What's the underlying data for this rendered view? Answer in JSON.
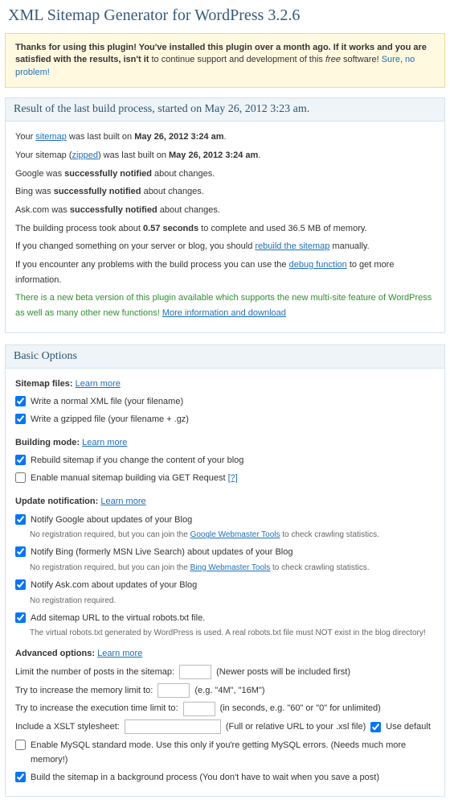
{
  "title": "XML Sitemap Generator for WordPress 3.2.6",
  "banner": {
    "text_before": "Thanks for using this plugin! You've installed this plugin over a month ago. If it works and you are satisfied with the results, isn't it",
    "text_after": " to continue support and development of this ",
    "free": "free",
    "software": " software! ",
    "link": "Sure, no problem!"
  },
  "result": {
    "heading": "Result of the last build process, started on May 26, 2012 3:23 am.",
    "l1a": "Your ",
    "l1_link": "sitemap",
    "l1b": " was last built on ",
    "l1_bold": "May 26, 2012 3:24 am",
    "l2a": "Your sitemap (",
    "l2_link": "zipped",
    "l2b": ") was last built on ",
    "l2_bold": "May 26, 2012 3:24 am",
    "l3a": "Google was ",
    "l3_bold": "successfully notified",
    "l3b": " about changes.",
    "l4a": "Bing was ",
    "l4_bold": "successfully notified",
    "l4b": " about changes.",
    "l5a": "Ask.com was ",
    "l5_bold": "successfully notified",
    "l5b": " about changes.",
    "l6a": "The building process took about ",
    "l6_bold": "0.57 seconds",
    "l6b": " to complete and used 36.5 MB of memory.",
    "l7a": "If you changed something on your server or blog, you should ",
    "l7_link": "rebuild the sitemap",
    "l7b": " manually.",
    "l8a": "If you encounter any problems with the build process you can use the ",
    "l8_link": "debug function",
    "l8b": " to get more information.",
    "beta_a": "There is a new beta version of this plugin available which supports the new multi-site feature of WordPress as well as many other new functions! ",
    "beta_link": "More information and download"
  },
  "basic": {
    "heading": "Basic Options",
    "files_label": "Sitemap files:",
    "learn": "Learn more",
    "opt_xml": "Write a normal XML file (your filename)",
    "opt_gz": "Write a gzipped file (your filename + .gz)",
    "build_label": "Building mode:",
    "opt_rebuild": "Rebuild sitemap if you change the content of your blog",
    "opt_manual": "Enable manual sitemap building via GET Request ",
    "opt_manual_q": "[?]",
    "update_label": "Update notification:",
    "opt_google": "Notify Google about updates of your Blog",
    "google_hint_a": "No registration required, but you can join the ",
    "google_hint_link": "Google Webmaster Tools",
    "google_hint_b": " to check crawling statistics.",
    "opt_bing": "Notify Bing (formerly MSN Live Search) about updates of your Blog",
    "bing_hint_a": "No registration required, but you can join the ",
    "bing_hint_link": "Bing Webmaster Tools",
    "bing_hint_b": " to check crawling statistics.",
    "opt_ask": "Notify Ask.com about updates of your Blog",
    "ask_hint": "No registration required.",
    "opt_robots": "Add sitemap URL to the virtual robots.txt file.",
    "robots_hint": "The virtual robots.txt generated by WordPress is used. A real robots.txt file must NOT exist in the blog directory!",
    "adv_label": "Advanced options:",
    "limit_a": "Limit the number of posts in the sitemap:",
    "limit_b": "(Newer posts will be included first)",
    "mem_a": "Try to increase the memory limit to:",
    "mem_b": "(e.g. \"4M\", \"16M\")",
    "exec_a": "Try to increase the execution time limit to:",
    "exec_b": "(in seconds, e.g. \"60\" or \"0\" for unlimited)",
    "xslt_a": "Include a XSLT stylesheet:",
    "xslt_b": "(Full or relative URL to your .xsl file)",
    "xslt_default": "Use default",
    "opt_mysql": "Enable MySQL standard mode. Use this only if you're getting MySQL errors. (Needs much more memory!)",
    "opt_bg": "Build the sitemap in a background process (You don't have to wait when you save a post)"
  }
}
